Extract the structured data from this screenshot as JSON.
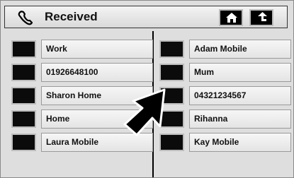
{
  "header": {
    "title": "Received"
  },
  "left_items": [
    {
      "label": "Work"
    },
    {
      "label": "01926648100"
    },
    {
      "label": "Sharon Home"
    },
    {
      "label": "Home"
    },
    {
      "label": "Laura Mobile"
    }
  ],
  "right_items": [
    {
      "label": "Adam Mobile"
    },
    {
      "label": "Mum"
    },
    {
      "label": "04321234567"
    },
    {
      "label": "Rihanna"
    },
    {
      "label": "Kay Mobile"
    }
  ],
  "icons": {
    "header": "phone-icon",
    "home": "home-icon",
    "back": "back-arrow-icon",
    "pointer": "mouse-cursor-icon"
  },
  "colors": {
    "background": "#dedede",
    "button_square": "#0b0b0b",
    "label_bg": "#eeeeee"
  }
}
